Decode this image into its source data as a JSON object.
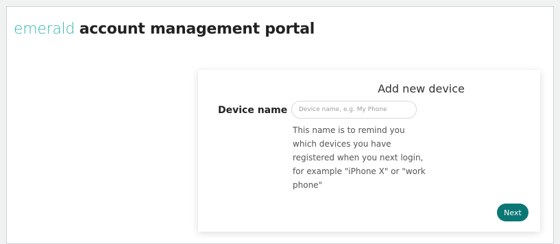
{
  "brand": {
    "accent": "emerald",
    "main": "account management portal"
  },
  "card": {
    "title": "Add new device",
    "field_label": "Device name",
    "input_value": "",
    "input_placeholder": "Device name, e.g. My Phone",
    "help_text": "This name is to remind you which devices you have registered when you next login, for example \"iPhone X\" or \"work phone\"",
    "next_label": "Next"
  },
  "colors": {
    "brand_accent": "#34b6ad",
    "button": "#0b7775"
  }
}
